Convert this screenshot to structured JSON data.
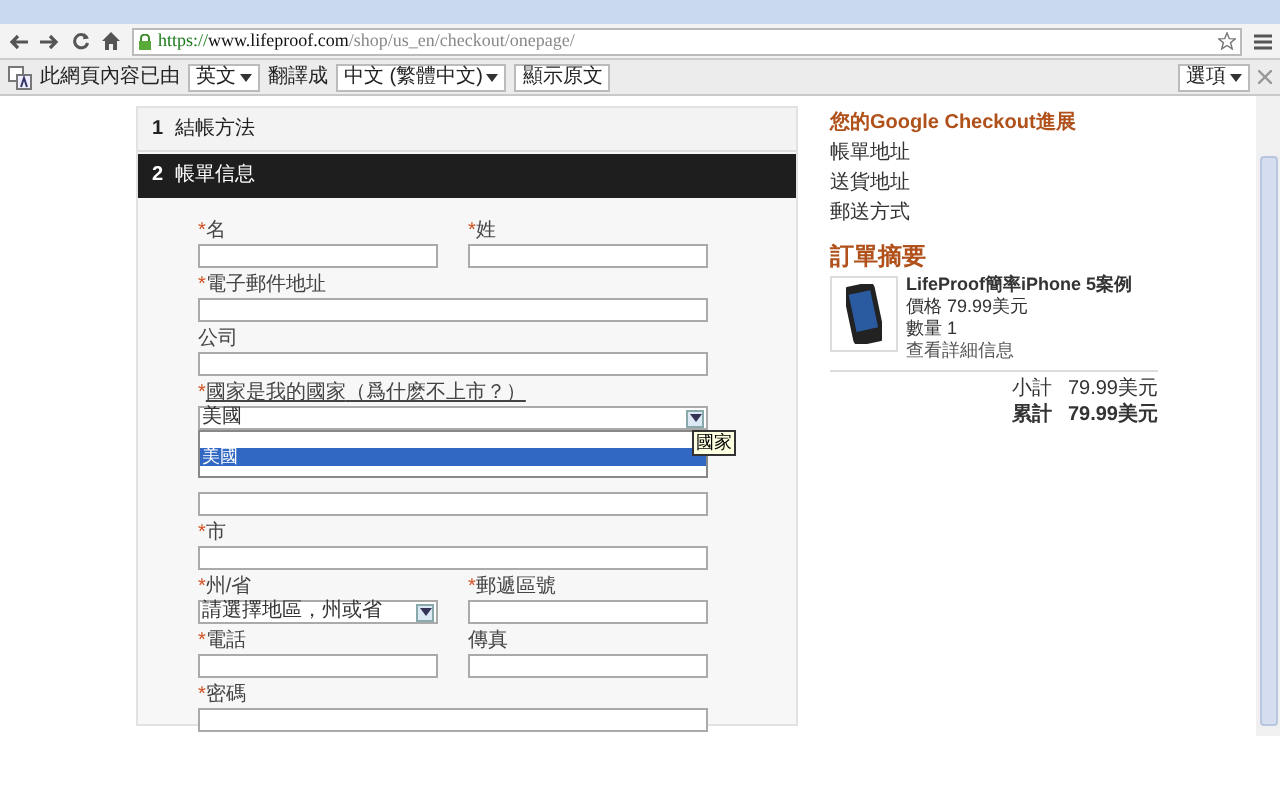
{
  "browser": {
    "url": {
      "scheme": "https://",
      "host": "www.lifeproof.com",
      "path": "/shop/us_en/checkout/onepage/",
      "secure": true
    }
  },
  "translate_bar": {
    "intro": "此網頁內容已由",
    "source_language": "英文",
    "middle": "翻譯成",
    "target_language": "中文 (繁體中文)",
    "show_original": "顯示原文",
    "options": "選項"
  },
  "steps": [
    {
      "number": "1",
      "title": "結帳方法",
      "selected": false
    },
    {
      "number": "2",
      "title": "帳單信息",
      "selected": true
    }
  ],
  "form_rows": [
    {
      "fields": [
        {
          "kind": "text",
          "required_mark": "*",
          "label": "名"
        },
        {
          "kind": "text",
          "required_mark": "*",
          "label": "姓"
        }
      ]
    },
    {
      "fields": [
        {
          "kind": "text",
          "required_mark": "*",
          "label": "電子郵件地址"
        }
      ]
    },
    {
      "fields": [
        {
          "kind": "text",
          "label": "公司"
        }
      ]
    },
    {
      "fields": [
        {
          "kind": "select",
          "required_mark": "*",
          "label": "國家是我的國家",
          "link": "（爲什麽不上市？）",
          "value": "美國",
          "open": true,
          "options": [
            {
              "label": "美國",
              "selected": true
            }
          ],
          "tooltip": "國家"
        }
      ]
    },
    {
      "fields": [
        {
          "kind": "text"
        }
      ]
    },
    {
      "fields": [
        {
          "kind": "text",
          "required_mark": "*",
          "label": "市"
        }
      ]
    },
    {
      "fields": [
        {
          "kind": "select",
          "required_mark": "*",
          "label": "州/省",
          "value": "請選擇地區，州或省",
          "open": false
        },
        {
          "kind": "text",
          "required_mark": "*",
          "label": "郵遞區號"
        }
      ]
    },
    {
      "fields": [
        {
          "kind": "text",
          "required_mark": "*",
          "label": "電話"
        },
        {
          "kind": "text",
          "label": "傳真"
        }
      ]
    },
    {
      "fields": [
        {
          "kind": "text",
          "required_mark": "*",
          "label": "密碼"
        }
      ]
    }
  ],
  "progress": {
    "title": "您的Google Checkout進展",
    "items": [
      "帳單地址",
      "送貨地址",
      "郵送方式"
    ]
  },
  "summary": {
    "title": "訂單摘要",
    "product": {
      "name": "LifeProof簡率iPhone 5案例",
      "price_label": "價格",
      "price": "79.99美元",
      "qty_label": "數量",
      "qty": "1",
      "details_link": "查看詳細信息"
    },
    "totals": [
      {
        "label": "小計",
        "value": "79.99美元",
        "grand": false
      },
      {
        "label": "累計",
        "value": "79.99美元",
        "grand": true
      }
    ]
  }
}
